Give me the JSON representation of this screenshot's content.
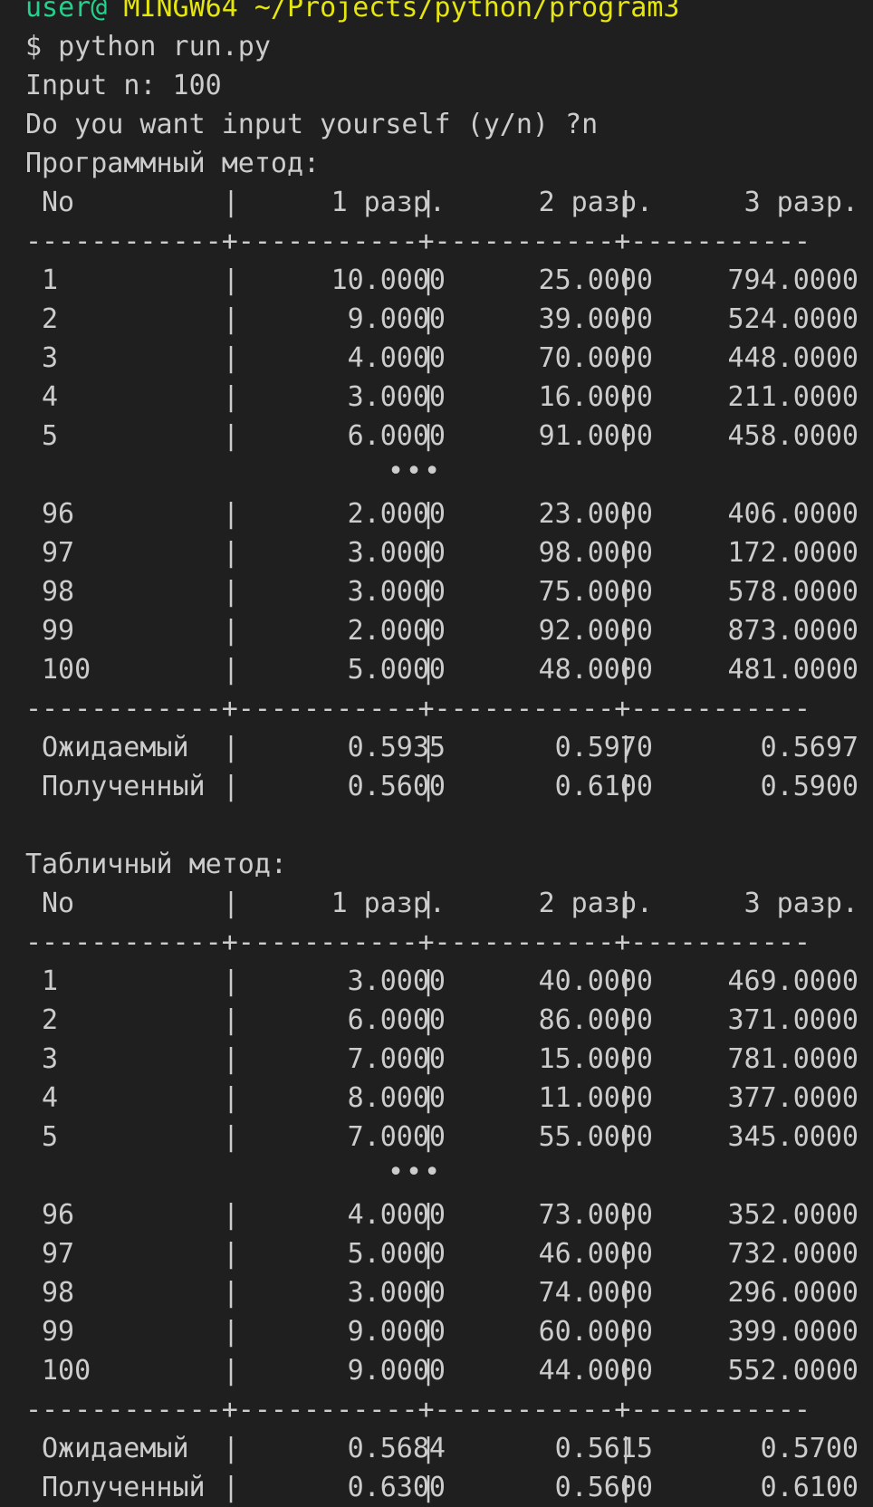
{
  "top_line": {
    "green": "user@",
    "yellow": "MINGW64 ~/Projects/python/program3"
  },
  "command": "$ python run.py",
  "input_prompt": "Input n: 100",
  "question": "Do you want input yourself (y/n) ?n",
  "separator_char": "|",
  "divider": "------------+-----------+-----------+-----------",
  "ellipsis": "•••",
  "tables": [
    {
      "title": "Программный метод:",
      "header": [
        "No",
        "1 разр.",
        "2 разр.",
        "3 разр."
      ],
      "rows_top": [
        [
          "1",
          "10.0000",
          "25.0000",
          "794.0000"
        ],
        [
          "2",
          "9.0000",
          "39.0000",
          "524.0000"
        ],
        [
          "3",
          "4.0000",
          "70.0000",
          "448.0000"
        ],
        [
          "4",
          "3.0000",
          "16.0000",
          "211.0000"
        ],
        [
          "5",
          "6.0000",
          "91.0000",
          "458.0000"
        ]
      ],
      "rows_bottom": [
        [
          "96",
          "2.0000",
          "23.0000",
          "406.0000"
        ],
        [
          "97",
          "3.0000",
          "98.0000",
          "172.0000"
        ],
        [
          "98",
          "3.0000",
          "75.0000",
          "578.0000"
        ],
        [
          "99",
          "2.0000",
          "92.0000",
          "873.0000"
        ],
        [
          "100",
          "5.0000",
          "48.0000",
          "481.0000"
        ]
      ],
      "summary": [
        [
          "Ожидаемый",
          "0.5935",
          "0.5970",
          "0.5697"
        ],
        [
          "Полученный",
          "0.5600",
          "0.6100",
          "0.5900"
        ]
      ]
    },
    {
      "title": "Табличный метод:",
      "header": [
        "No",
        "1 разр.",
        "2 разр.",
        "3 разр."
      ],
      "rows_top": [
        [
          "1",
          "3.0000",
          "40.0000",
          "469.0000"
        ],
        [
          "2",
          "6.0000",
          "86.0000",
          "371.0000"
        ],
        [
          "3",
          "7.0000",
          "15.0000",
          "781.0000"
        ],
        [
          "4",
          "8.0000",
          "11.0000",
          "377.0000"
        ],
        [
          "5",
          "7.0000",
          "55.0000",
          "345.0000"
        ]
      ],
      "rows_bottom": [
        [
          "96",
          "4.0000",
          "73.0000",
          "352.0000"
        ],
        [
          "97",
          "5.0000",
          "46.0000",
          "732.0000"
        ],
        [
          "98",
          "3.0000",
          "74.0000",
          "296.0000"
        ],
        [
          "99",
          "9.0000",
          "60.0000",
          "399.0000"
        ],
        [
          "100",
          "9.0000",
          "44.0000",
          "552.0000"
        ]
      ],
      "summary": [
        [
          "Ожидаемый",
          "0.5684",
          "0.5615",
          "0.5700"
        ],
        [
          "Полученный",
          "0.6300",
          "0.5600",
          "0.6100"
        ]
      ]
    }
  ]
}
